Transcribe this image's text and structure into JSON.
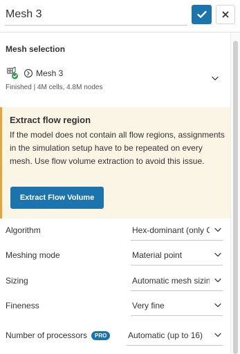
{
  "header": {
    "title_value": "Mesh 3",
    "confirm_icon": "check-icon",
    "close_icon": "close-icon"
  },
  "mesh_selection": {
    "section_title": "Mesh selection",
    "mesh_name": "Mesh 3",
    "status": "Finished | 4M cells, 4.8M nodes"
  },
  "info_box": {
    "title": "Extract flow region",
    "text": "If the model does not contain all flow regions, assignments in the simulation setup have to be repeated on every mesh. Use flow volume extraction to avoid this issue.",
    "button_label": "Extract Flow Volume"
  },
  "properties": [
    {
      "label": "Algorithm",
      "value": "Hex-dominant (only CFD)"
    },
    {
      "label": "Meshing mode",
      "value": "Material point"
    },
    {
      "label": "Sizing",
      "value": "Automatic mesh sizing"
    },
    {
      "label": "Fineness",
      "value": "Very fine"
    },
    {
      "label": "Number of processors",
      "badge": "PRO",
      "value": "Automatic (up to 16)"
    }
  ],
  "colors": {
    "accent": "#1b74ad",
    "warning_border": "#e2a43b",
    "warning_bg": "#fbf5e6",
    "success": "#2e9d4a"
  }
}
